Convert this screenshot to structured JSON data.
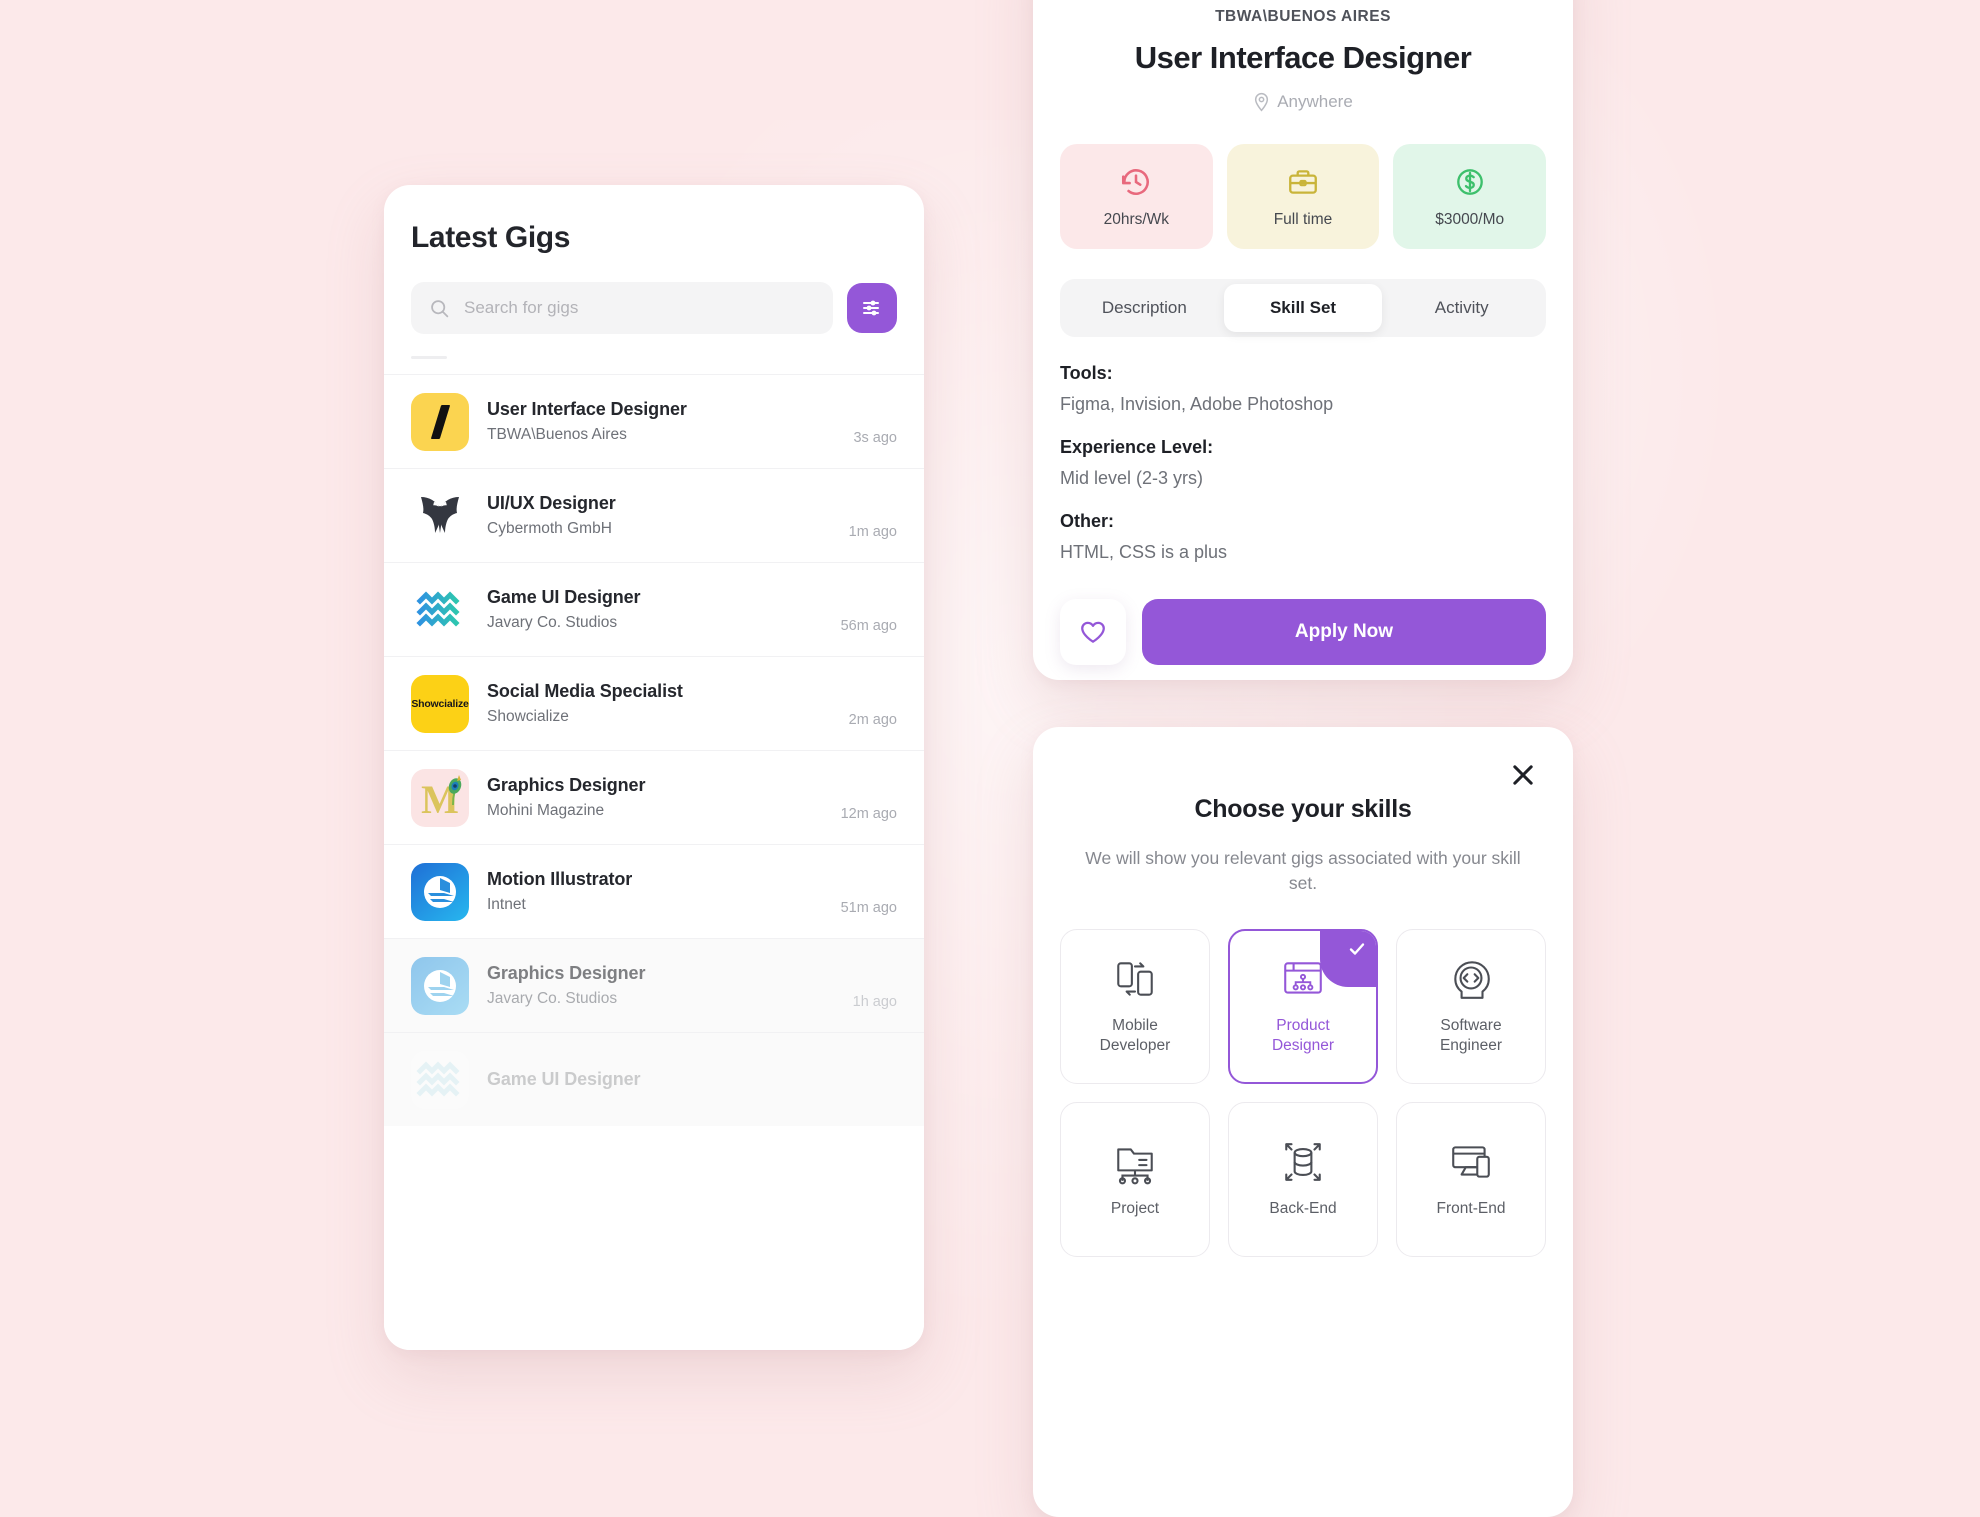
{
  "background_color": "#fce9ea",
  "accent_color": "#9457d8",
  "gigs_panel": {
    "title": "Latest Gigs",
    "search": {
      "placeholder": "Search for gigs",
      "value": ""
    },
    "filter_button_label": "Filters",
    "items": [
      {
        "role": "User Interface Designer",
        "company": "TBWA\\Buenos Aires",
        "time": "3s ago",
        "logo": "tbwa-logo"
      },
      {
        "role": "UI/UX Designer",
        "company": "Cybermoth GmbH",
        "time": "1m ago",
        "logo": "cybermoth-logo"
      },
      {
        "role": "Game UI Designer",
        "company": "Javary Co. Studios",
        "time": "56m ago",
        "logo": "javary-waves-logo"
      },
      {
        "role": "Social Media Specialist",
        "company": "Showcialize",
        "time": "2m ago",
        "logo": "showcialize-logo"
      },
      {
        "role": "Graphics Designer",
        "company": "Mohini Magazine",
        "time": "12m ago",
        "logo": "mohini-logo"
      },
      {
        "role": "Motion Illustrator",
        "company": "Intnet",
        "time": "51m ago",
        "logo": "intnet-logo"
      },
      {
        "role": "Graphics Designer",
        "company": "Javary Co. Studios",
        "time": "1h ago",
        "logo": "intnet-faded-logo"
      },
      {
        "role": "Game UI Designer",
        "company": "",
        "time": "",
        "logo": "javary-waves-faded-logo"
      }
    ]
  },
  "job_panel": {
    "company": "TBWA\\BUENOS AIRES",
    "title": "User Interface Designer",
    "location": "Anywhere",
    "stats": [
      {
        "label": "20hrs/Wk",
        "icon": "clock-icon",
        "color": "#e8697d"
      },
      {
        "label": "Full time",
        "icon": "briefcase-icon",
        "color": "#c9b43a"
      },
      {
        "label": "$3000/Mo",
        "icon": "dollar-icon",
        "color": "#3dc06c"
      }
    ],
    "tabs": [
      {
        "label": "Description",
        "active": false
      },
      {
        "label": "Skill Set",
        "active": true
      },
      {
        "label": "Activity",
        "active": false
      }
    ],
    "skill_set": [
      {
        "label": "Tools:",
        "value": "Figma, Invision, Adobe Photoshop"
      },
      {
        "label": "Experience Level:",
        "value": "Mid level (2-3 yrs)"
      },
      {
        "label": "Other:",
        "value": "HTML, CSS is a plus"
      }
    ],
    "favorite_button": "heart-icon",
    "apply_label": "Apply Now"
  },
  "skills_modal": {
    "close_label": "close-icon",
    "title": "Choose your skills",
    "subtitle": "We will show you relevant gigs associated with your skill set.",
    "options": [
      {
        "label": "Mobile\nDeveloper",
        "line1": "Mobile",
        "line2": "Developer",
        "icon": "mobile-devices-icon",
        "selected": false
      },
      {
        "label": "Product Designer",
        "line1": "Product",
        "line2": "Designer",
        "icon": "wireframe-icon",
        "selected": true
      },
      {
        "label": "Software Engineer",
        "line1": "Software",
        "line2": "Engineer",
        "icon": "code-head-icon",
        "selected": false
      },
      {
        "label": "Project",
        "line1": "Project",
        "line2": "",
        "icon": "project-folder-icon",
        "selected": false
      },
      {
        "label": "Back-End",
        "line1": "Back-End",
        "line2": "",
        "icon": "database-arrows-icon",
        "selected": false
      },
      {
        "label": "Front-End",
        "line1": "Front-End",
        "line2": "",
        "icon": "devices-icon",
        "selected": false
      }
    ]
  }
}
